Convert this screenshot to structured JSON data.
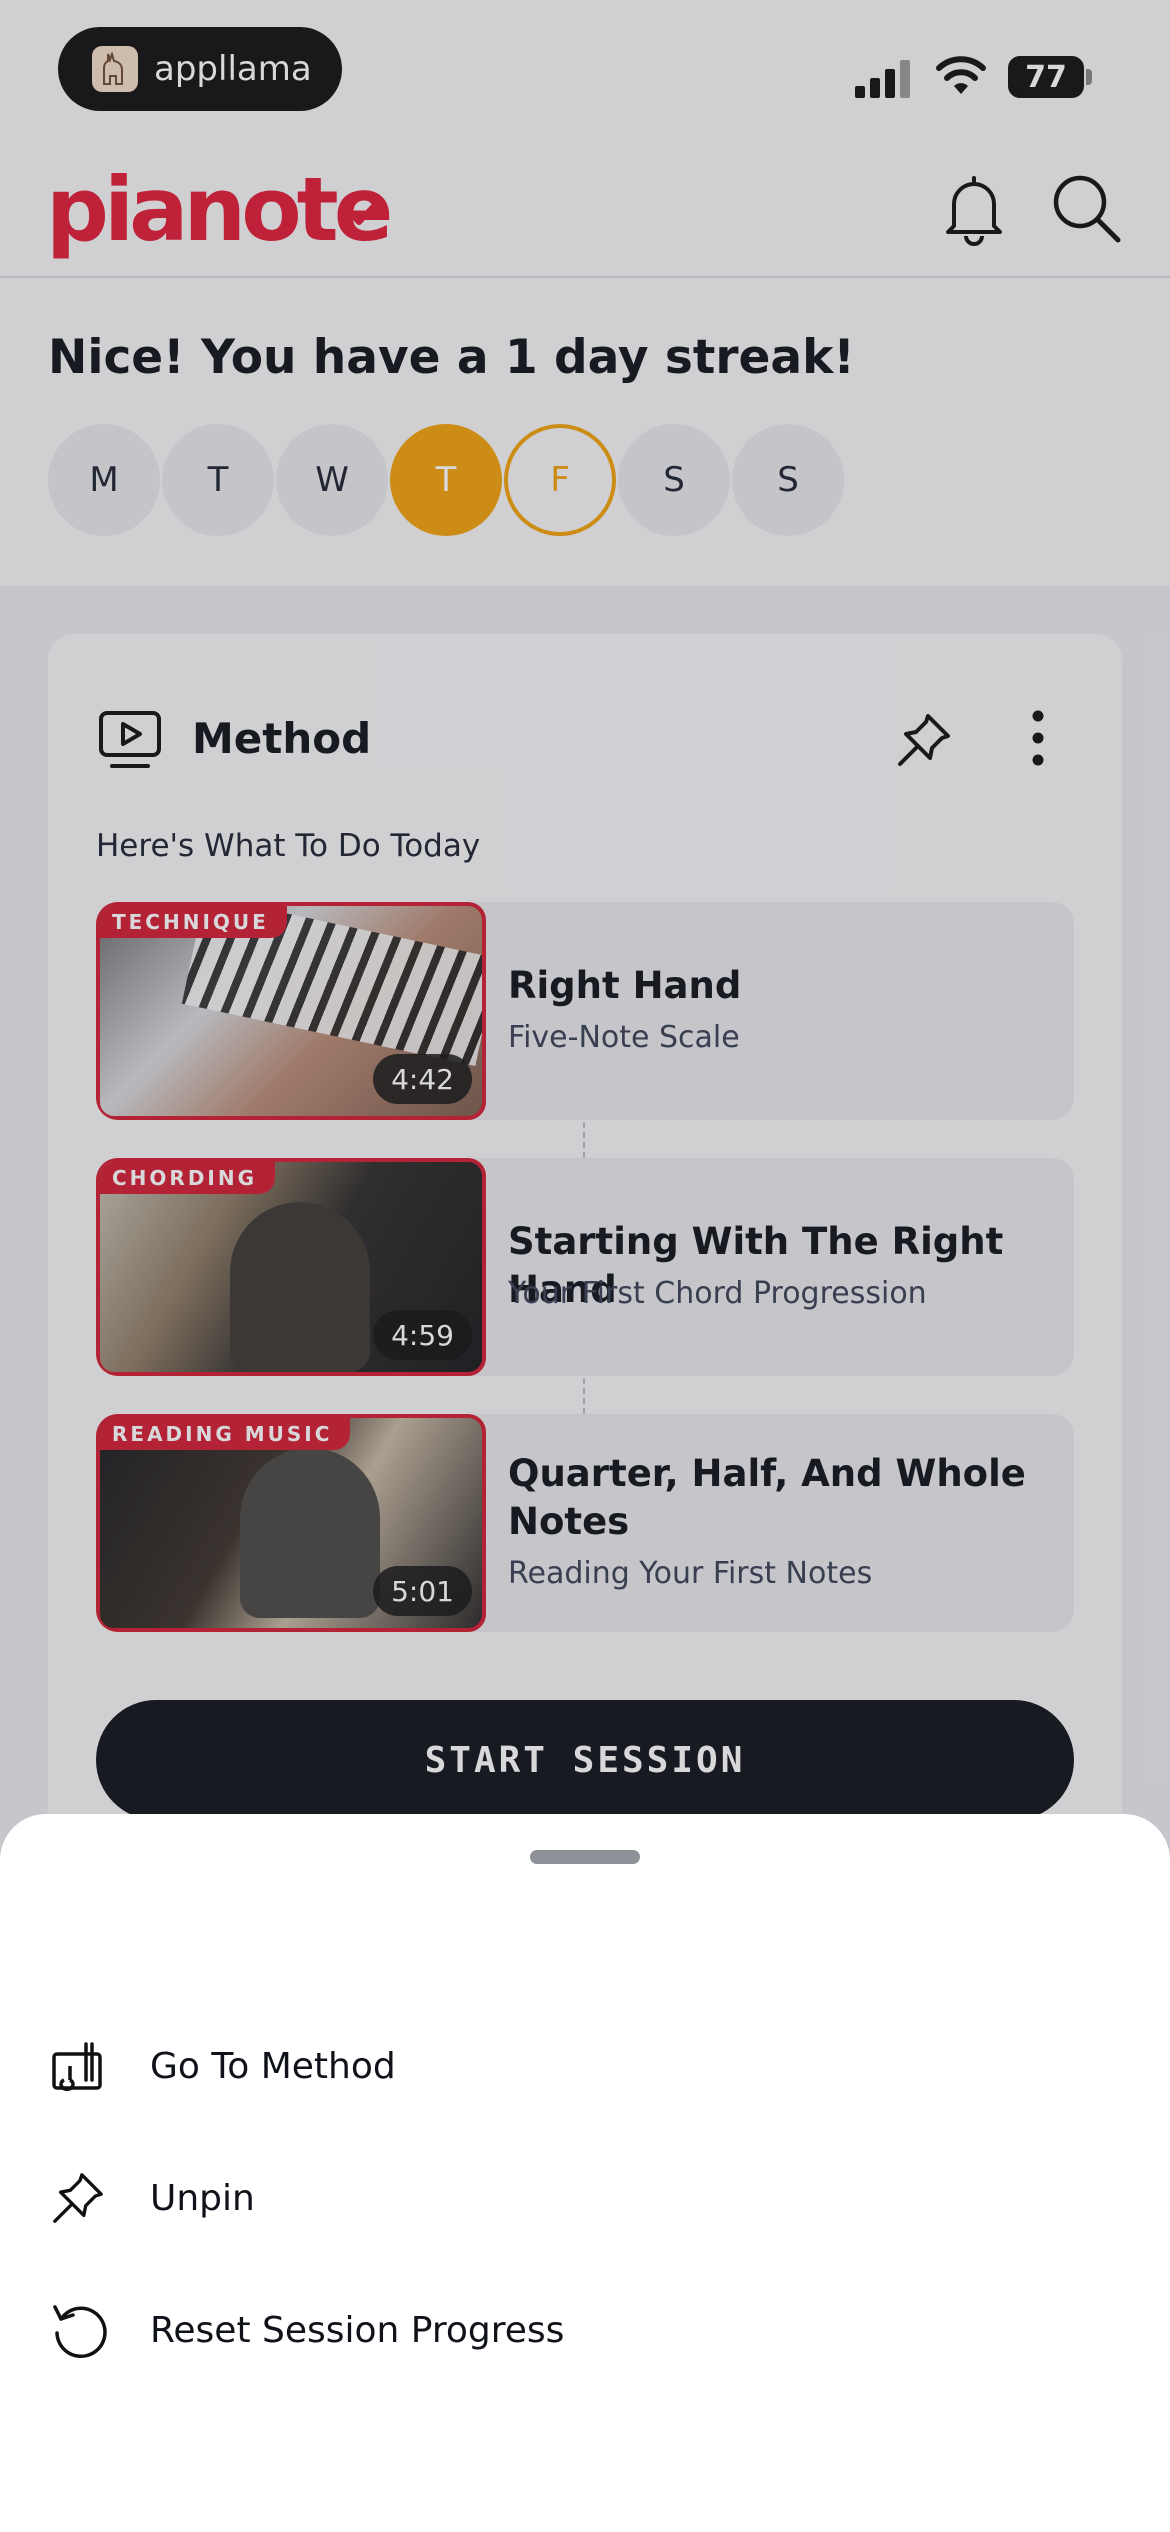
{
  "status_bar": {
    "app_name": "appllama",
    "battery": "77"
  },
  "header": {
    "logo": "pianote",
    "brand_color": "#e01b35"
  },
  "streak": {
    "title": "Nice! You have a 1 day streak!",
    "days": [
      "M",
      "T",
      "W",
      "T",
      "F",
      "S",
      "S"
    ],
    "accent_color": "#f1a10b"
  },
  "card": {
    "title": "Method",
    "subtitle": "Here's What To Do Today",
    "lessons": [
      {
        "tag": "TECHNIQUE",
        "duration": "4:42",
        "title": "Right Hand",
        "subtitle": "Five-Note Scale"
      },
      {
        "tag": "CHORDING",
        "duration": "4:59",
        "title": "Starting With The Right Hand",
        "subtitle": "Your First Chord Progression"
      },
      {
        "tag": "READING MUSIC",
        "duration": "5:01",
        "title": "Quarter, Half, And Whole Notes",
        "subtitle": "Reading Your First Notes"
      }
    ],
    "start_button": "START SESSION"
  },
  "sheet": {
    "items": [
      {
        "label": "Go To Method",
        "icon": "method-icon"
      },
      {
        "label": "Unpin",
        "icon": "pin-icon"
      },
      {
        "label": "Reset Session Progress",
        "icon": "reset-icon"
      }
    ]
  }
}
